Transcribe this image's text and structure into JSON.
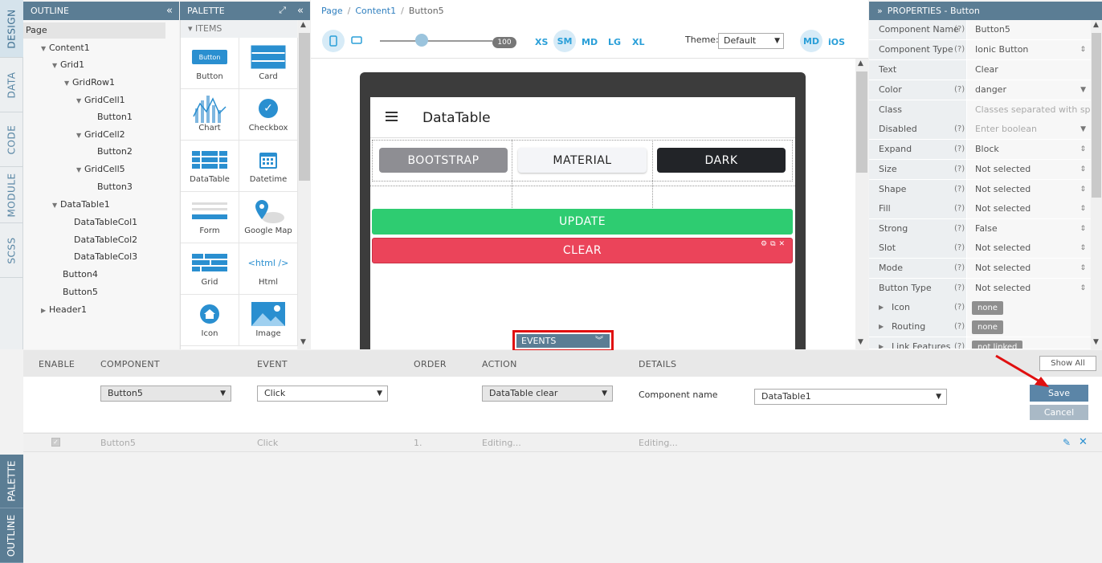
{
  "left_tabs": [
    "DESIGN",
    "DATA",
    "CODE",
    "MODULE",
    "SCSS"
  ],
  "bottom_tabs": [
    "PALETTE",
    "OUTLINE"
  ],
  "outline": {
    "title": "OUTLINE",
    "root": "Page",
    "items": [
      "Content1",
      "Grid1",
      "GridRow1",
      "GridCell1",
      "Button1",
      "GridCell2",
      "Button2",
      "GridCell5",
      "Button3",
      "DataTable1",
      "DataTableCol1",
      "DataTableCol2",
      "DataTableCol3",
      "Button4",
      "Button5",
      "Header1"
    ]
  },
  "palette": {
    "title": "PALETTE",
    "section": "ITEMS",
    "items": [
      "Button",
      "Card",
      "Chart",
      "Checkbox",
      "DataTable",
      "Datetime",
      "Form",
      "Google Map",
      "Grid",
      "Html",
      "Icon",
      "Image"
    ],
    "html_icon_text": "<html />",
    "button_icon_text": "Button"
  },
  "breadcrumb": [
    "Page",
    "Content1",
    "Button5"
  ],
  "toolbar": {
    "zoom": "100",
    "sizes": [
      "XS",
      "SM",
      "MD",
      "LG",
      "XL"
    ],
    "theme_label": "Theme:",
    "theme_value": "Default",
    "md": "MD",
    "ios": "iOS"
  },
  "preview": {
    "title": "DataTable",
    "buttons": [
      "BOOTSTRAP",
      "MATERIAL",
      "DARK"
    ],
    "update": "UPDATE",
    "clear": "CLEAR",
    "colors": {
      "update": "#2ecc71",
      "clear": "#eb445a",
      "bootstrap": "#8e8e93",
      "dark": "#222428"
    }
  },
  "events_tab": "EVENTS",
  "properties": {
    "title": "PROPERTIES - Button",
    "rows": [
      {
        "name": "Component Name",
        "q": "(?)",
        "value": "Button5"
      },
      {
        "name": "Component Type",
        "q": "(?)",
        "value": "Ionic Button"
      },
      {
        "name": "Text",
        "q": "",
        "value": "Clear"
      },
      {
        "name": "Color",
        "q": "(?)",
        "value": "danger"
      },
      {
        "name": "Class",
        "q": "",
        "value": "Classes separated with spa"
      },
      {
        "name": "Disabled",
        "q": "(?)",
        "value": "Enter boolean"
      },
      {
        "name": "Expand",
        "q": "(?)",
        "value": "Block"
      },
      {
        "name": "Size",
        "q": "(?)",
        "value": "Not selected"
      },
      {
        "name": "Shape",
        "q": "(?)",
        "value": "Not selected"
      },
      {
        "name": "Fill",
        "q": "(?)",
        "value": "Not selected"
      },
      {
        "name": "Strong",
        "q": "(?)",
        "value": "False"
      },
      {
        "name": "Slot",
        "q": "(?)",
        "value": "Not selected"
      },
      {
        "name": "Mode",
        "q": "(?)",
        "value": "Not selected"
      },
      {
        "name": "Button Type",
        "q": "(?)",
        "value": "Not selected"
      },
      {
        "name": "Icon",
        "q": "(?)",
        "value": "none"
      },
      {
        "name": "Routing",
        "q": "(?)",
        "value": "none"
      },
      {
        "name": "Link Features",
        "q": "(?)",
        "value": "not linked"
      }
    ]
  },
  "events": {
    "headers": [
      "ENABLE",
      "COMPONENT",
      "EVENT",
      "ORDER",
      "ACTION",
      "DETAILS"
    ],
    "component": "Button5",
    "event": "Click",
    "action": "DataTable clear",
    "detail_label": "Component name",
    "detail_value": "DataTable1",
    "save": "Save",
    "cancel": "Cancel",
    "show_all": "Show All",
    "row": {
      "component": "Button5",
      "event": "Click",
      "order": "1.",
      "action": "Editing...",
      "details": "Editing..."
    }
  }
}
